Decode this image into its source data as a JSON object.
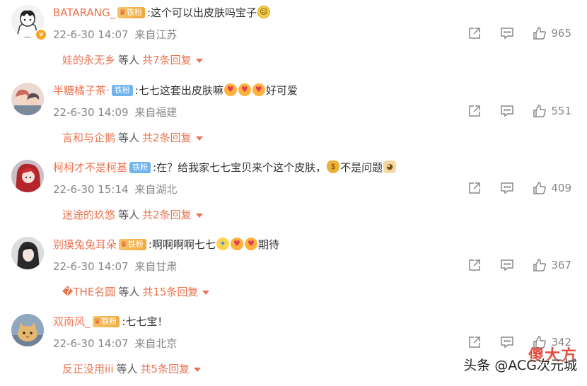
{
  "comments": [
    {
      "username": "BATARANG_",
      "badge": "铁粉",
      "badge_style": "gold",
      "text": ":这个可以出皮肤吗宝子",
      "emojis_after": [
        "sad"
      ],
      "date": "22-6-30 14:07",
      "location": "来自江苏",
      "likes": "965",
      "reply_user": "娃的永无乡",
      "reply_mid": "等人",
      "reply_count": "共7条回复",
      "verified": true
    },
    {
      "username": "半糖橘子茶·",
      "badge": "铁粉",
      "badge_style": "blue",
      "text": ":七七这套出皮肤嘛",
      "emojis_after": [
        "heart",
        "heart",
        "heart"
      ],
      "text_tail": "好可爱",
      "date": "22-6-30 14:09",
      "location": "来自福建",
      "likes": "551",
      "reply_user": "言和与企鹅",
      "reply_mid": "等人",
      "reply_count": "共2条回复"
    },
    {
      "username": "柯柯才不是柯基",
      "badge": "铁粉",
      "badge_style": "blue",
      "text": ":在？给我家七七宝贝来个这个皮肤，",
      "emojis_after": [
        "bag"
      ],
      "text_tail": "不是问题",
      "emojis_end": [
        "doge"
      ],
      "date": "22-6-30 15:14",
      "location": "来自湖北",
      "likes": "409",
      "reply_user": "迷途的玖悠",
      "reply_mid": "等人",
      "reply_count": "共2条回复"
    },
    {
      "username": "别摸兔兔耳朵",
      "badge": "铁粉",
      "badge_style": "gold",
      "text": ":啊啊啊啊七七",
      "emojis_after": [
        "cry",
        "heart",
        "heart"
      ],
      "text_tail": "期待",
      "date": "22-6-30 14:07",
      "location": "来自甘肃",
      "likes": "367",
      "reply_user": "�THE名圆",
      "reply_mid": "等人",
      "reply_count": "共15条回复"
    },
    {
      "username": "双南风_",
      "badge": "铁粉",
      "badge_style": "gold",
      "text": ":七七宝！",
      "emojis_after": [],
      "date": "22-6-30 14:07",
      "location": "来自北京",
      "likes": "342",
      "reply_user": "反正没用iii",
      "reply_mid": "等人",
      "reply_count": "共5条回复"
    }
  ],
  "icons": {
    "share": "share-icon",
    "comment": "comment-icon",
    "like": "thumbs-up-icon"
  },
  "watermark": "头条 @ACG次元城",
  "stamp_text": "傻大方",
  "colors": {
    "username": "#eb7350",
    "meta": "#888888",
    "fan_badge_blue": "#6fb4ed",
    "fan_badge_gold": "#f0a93c"
  }
}
